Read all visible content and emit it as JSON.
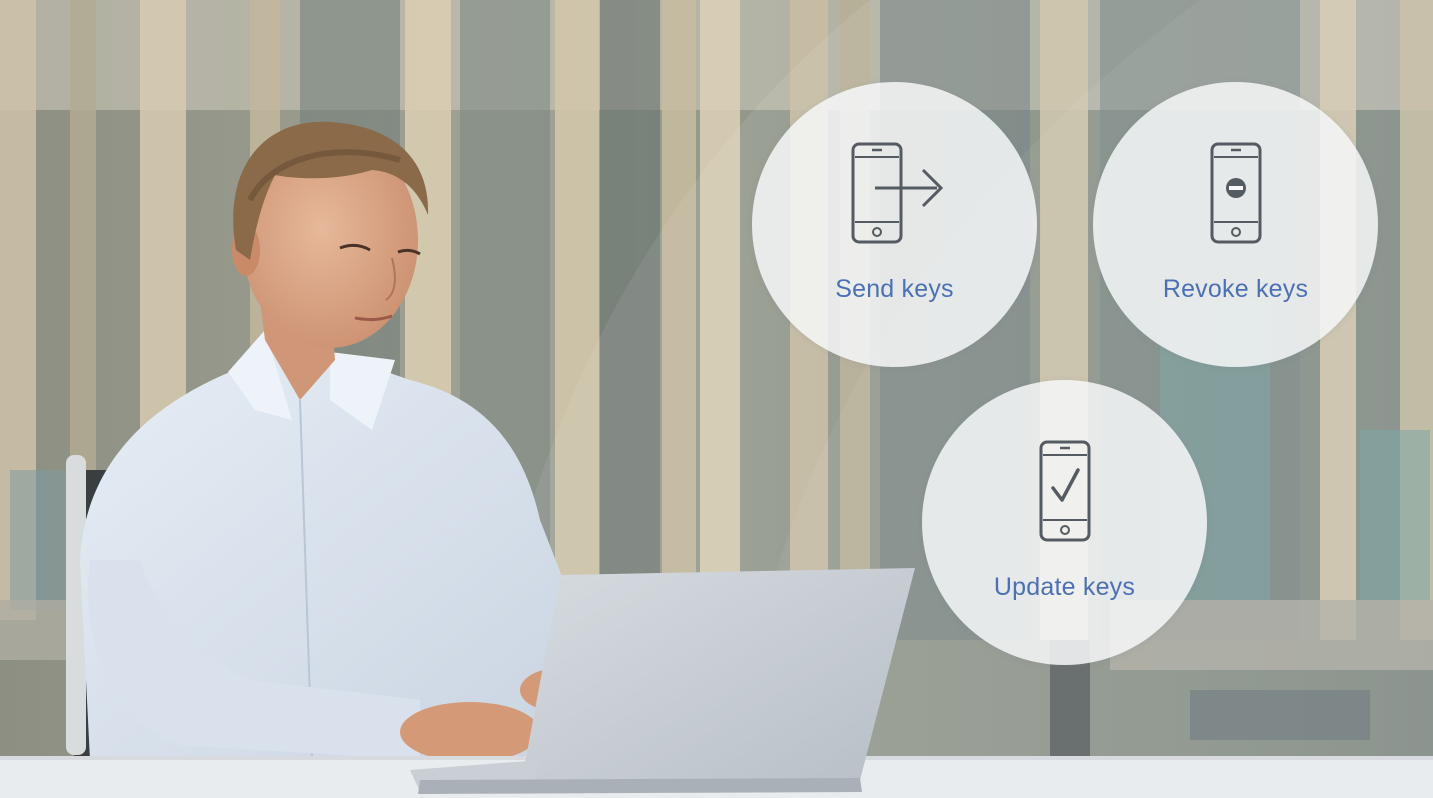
{
  "features": [
    {
      "id": "send",
      "label": "Send keys",
      "icon": "phone-send-icon"
    },
    {
      "id": "revoke",
      "label": "Revoke keys",
      "icon": "phone-revoke-icon"
    },
    {
      "id": "update",
      "label": "Update keys",
      "icon": "phone-update-icon"
    }
  ],
  "colors": {
    "accent": "#4b70b6",
    "icon_stroke": "#555b62",
    "circle_fill": "#f6f7f8"
  }
}
